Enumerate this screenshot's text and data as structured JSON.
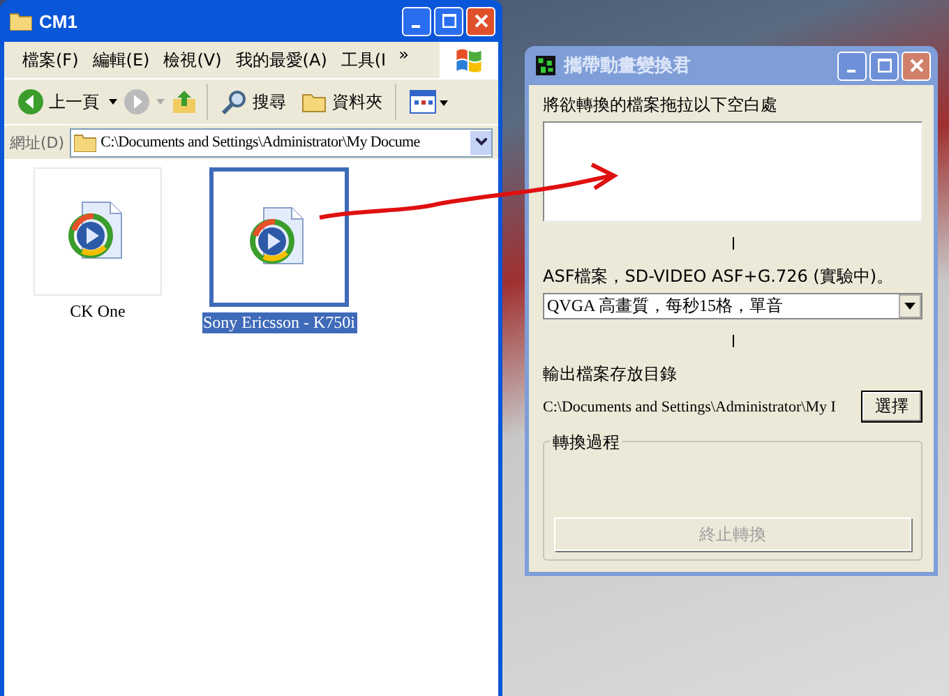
{
  "explorer": {
    "title": "CM1",
    "menu": [
      {
        "label": "檔案(F)"
      },
      {
        "label": "編輯(E)"
      },
      {
        "label": "檢視(V)"
      },
      {
        "label": "我的最愛(A)"
      },
      {
        "label": "工具(I"
      }
    ],
    "menu_overflow": "»",
    "toolbar": {
      "back": "上一頁",
      "search": "搜尋",
      "folders": "資料夾"
    },
    "address": {
      "label": "網址(D)",
      "value": "C:\\Documents and Settings\\Administrator\\My Docume"
    },
    "files": [
      {
        "name": "CK One",
        "selected": false
      },
      {
        "name": "Sony Ericsson - K750i",
        "selected": true
      }
    ]
  },
  "converter": {
    "title": "攜帶動畫變換君",
    "drop_label": "將欲轉換的檔案拖拉以下空白處",
    "format_label": "ASF檔案，SD-VIDEO ASF+G.726 (實驗中)。",
    "preset": "QVGA 高畫質，每秒15格，單音",
    "output_label": "輸出檔案存放目錄",
    "output_path": "C:\\Documents and Settings\\Administrator\\My I",
    "choose_button": "選擇",
    "progress_group": "轉換過程",
    "stop_button": {
      "label": "終止轉換",
      "disabled": true
    }
  }
}
